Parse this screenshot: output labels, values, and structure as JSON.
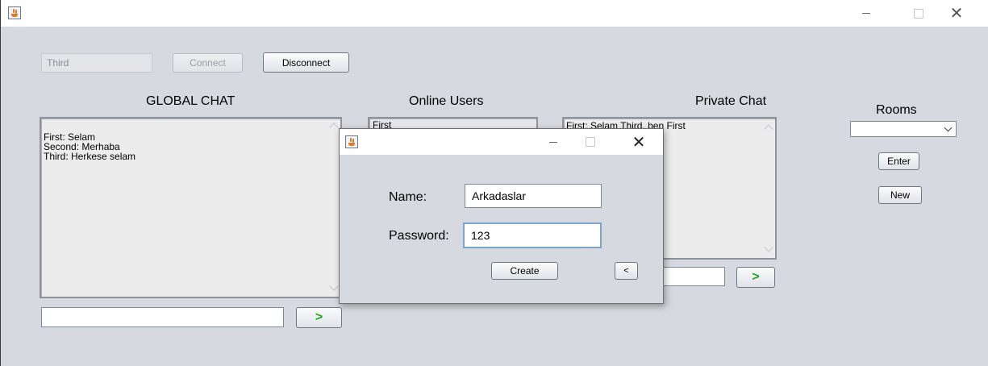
{
  "main": {
    "username_value": "Third",
    "connect_label": "Connect",
    "disconnect_label": "Disconnect",
    "global_chat": {
      "title": "GLOBAL CHAT",
      "messages": [
        "First: Selam",
        "Second: Merhaba",
        "Third: Herkese selam"
      ],
      "input_value": "",
      "send_label": ">"
    },
    "online_users": {
      "title": "Online Users",
      "users": [
        "First"
      ]
    },
    "private_chat": {
      "title": "Private Chat",
      "messages": [
        "First: Selam Third, ben First"
      ],
      "input_value": "",
      "send_label": ">"
    },
    "rooms": {
      "title": "Rooms",
      "selected": "",
      "enter_label": "Enter",
      "new_label": "New"
    }
  },
  "dialog": {
    "name_label": "Name:",
    "name_value": "Arkadaslar",
    "password_label": "Password:",
    "password_value": "123",
    "create_label": "Create",
    "back_label": "<"
  },
  "icons": {
    "app": "java-cup-icon",
    "minimize": "minimize-icon",
    "maximize": "maximize-icon",
    "close": "close-icon"
  }
}
